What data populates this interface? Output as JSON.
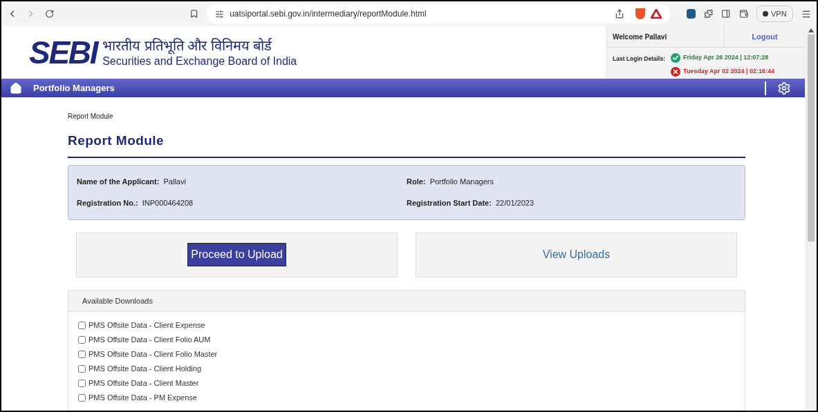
{
  "browser": {
    "url": "uatsiportal.sebi.gov.in/intermediary/reportModule.html",
    "vpn_label": "VPN"
  },
  "header": {
    "logo_text": "SEBI",
    "hindi_name": "भारतीय प्रतिभूति और विनिमय बोर्ड",
    "english_name": "Securities and Exchange Board of India",
    "welcome": "Welcome Pallavi",
    "logout": "Logout",
    "last_login_label": "Last Login Details:",
    "logins": [
      {
        "successful": true,
        "text": "Friday Apr 26 2024 | 12:07:28"
      },
      {
        "successful": false,
        "text": "Tuesday Apr 02 2024 | 02:16:44"
      }
    ]
  },
  "nav": {
    "title": "Portfolio Managers"
  },
  "breadcrumb": "Report Module",
  "page_title": "Report Module",
  "applicant": [
    {
      "label": "Name of the Applicant:",
      "value": "Pallavi"
    },
    {
      "label": "Role:",
      "value": "Portfolio Managers"
    },
    {
      "label": "Registration No.:",
      "value": "INP000464208"
    },
    {
      "label": "Registration Start Date:",
      "value": "22/01/2023"
    }
  ],
  "actions": [
    {
      "label": "Proceed to Upload",
      "kind": "primary"
    },
    {
      "label": "View Uploads",
      "kind": "link"
    }
  ],
  "downloads": {
    "title": "Available Downloads",
    "items": [
      {
        "label": "PMS Offsite Data - Client Expense",
        "checked": false
      },
      {
        "label": "PMS Offsite Data - Client Folio AUM",
        "checked": false
      },
      {
        "label": "PMS Offsite Data - Client Folio Master",
        "checked": false
      },
      {
        "label": "PMS Offsite Data - Client Holding",
        "checked": false
      },
      {
        "label": "PMS Offsite Data - Client Master",
        "checked": false
      },
      {
        "label": "PMS Offsite Data - PM Expense",
        "checked": false
      }
    ]
  }
}
